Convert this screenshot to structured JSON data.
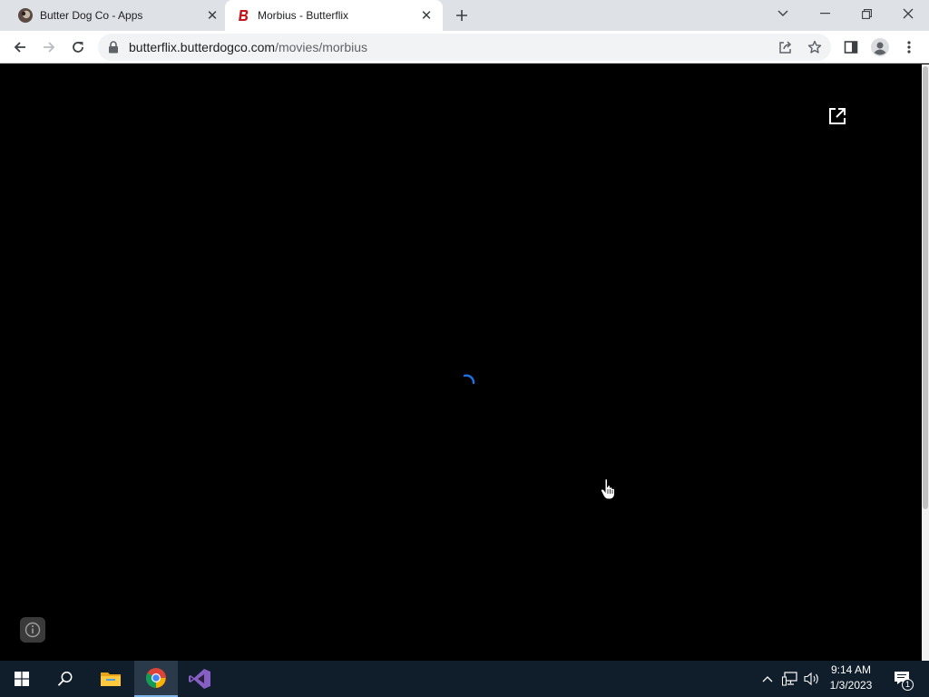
{
  "browser": {
    "tabs": [
      {
        "title": "Butter Dog Co - Apps",
        "favicon": "dog-avatar-icon",
        "active": false
      },
      {
        "title": "Morbius - Butterflix",
        "favicon": "butterflix-b-logo-icon",
        "active": true
      }
    ],
    "address_bar": {
      "host": "butterflix.butterdogco.com",
      "path": "/movies/morbius"
    },
    "toolbar_icons": [
      "back-icon",
      "forward-icon",
      "reload-icon",
      "share-icon",
      "star-icon",
      "side-panel-icon",
      "profile-icon",
      "menu-icon"
    ]
  },
  "page": {
    "background_color": "#000000",
    "state": "loading",
    "spinner_color": "#1a73e8",
    "icons": [
      "open-in-new-icon",
      "info-icon"
    ]
  },
  "taskbar": {
    "apps": [
      "windows-start-icon",
      "search-icon",
      "file-explorer-icon",
      "chrome-icon",
      "visual-studio-icon"
    ],
    "active_app": "chrome-icon",
    "tray_icons": [
      "chevron-up-icon",
      "network-icon",
      "volume-icon",
      "notifications-icon"
    ],
    "time": "9:14 AM",
    "date": "1/3/2023",
    "notification_count": "1"
  }
}
